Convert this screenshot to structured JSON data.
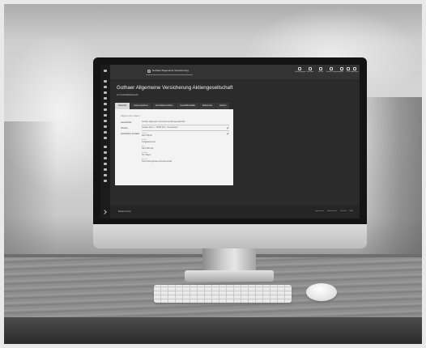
{
  "app": {
    "search_query": "Gothaer Allgemeine Versicherung"
  },
  "topbar": {
    "items": [
      {
        "label": "Verknüpfungen",
        "icon": "link-icon"
      },
      {
        "label": "Favoriten",
        "icon": "star-icon"
      },
      {
        "label": "Verlauf",
        "icon": "history-icon"
      },
      {
        "label": "Benachrichtigungen",
        "icon": "bell-icon"
      },
      {
        "label": "Hilfe",
        "icon": "help-icon"
      },
      {
        "label": "Profil",
        "icon": "user-icon"
      },
      {
        "label": "Abmelden",
        "icon": "logout-icon"
      }
    ]
  },
  "page": {
    "title": "Gothaer Allgemeine Versicherung Aktiengesellschaft",
    "subtitle": "zur Geschäftsübersicht"
  },
  "tabs": [
    {
      "label": "Übersicht",
      "active": true
    },
    {
      "label": "Ansprechpartner",
      "active": false
    },
    {
      "label": "Vertriebskennzahlen",
      "active": false
    },
    {
      "label": "Geschäftsvorfälle",
      "active": false
    },
    {
      "label": "Dokumente",
      "active": false
    },
    {
      "label": "Notizen",
      "active": false
    }
  ],
  "card": {
    "title": "Allgemeine Daten",
    "rows": [
      {
        "label": "Gesellschaft",
        "value": "Gothaer Allgemeine Versicherung Aktiengesellschaft"
      },
      {
        "label": "Adresse",
        "value": "Gothaer Allee 1 · 50969 Köln · Deutschland"
      },
      {
        "label": "Vertriebliche Kontakte",
        "value": "Telefon"
      }
    ],
    "contacts": [
      {
        "caption": "Telefon",
        "value": "0221 308-00"
      },
      {
        "caption": "E-Mail",
        "value": "info@gothaer.de"
      },
      {
        "caption": "Fax",
        "value": "0221 308-103"
      },
      {
        "caption": "Kontakt",
        "value": "Herr Mayer"
      },
      {
        "caption": "Internet",
        "value": "https://www.gothaer.de/maklerportal/"
      }
    ]
  },
  "footer": {
    "brand": "Makler Portal",
    "links": [
      "Impressum",
      "Datenschutz",
      "Kontakt",
      "FAQ"
    ]
  }
}
